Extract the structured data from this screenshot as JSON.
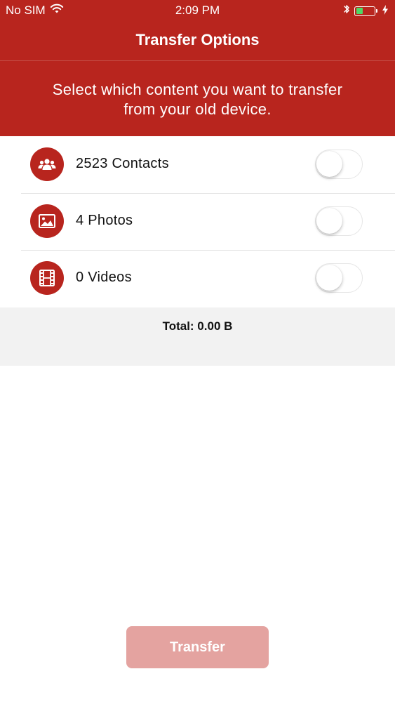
{
  "status_bar": {
    "carrier": "No SIM",
    "time": "2:09 PM",
    "battery_level": 0.45,
    "battery_color": "#4CD964",
    "icons": [
      "wifi-icon",
      "bluetooth-icon",
      "battery-icon",
      "charging-bolt-icon"
    ]
  },
  "nav": {
    "title": "Transfer Options"
  },
  "header": {
    "subtitle": "Select which content you want to transfer from your old device."
  },
  "items": [
    {
      "label": "2523 Contacts",
      "icon": "contacts-icon",
      "enabled": false
    },
    {
      "label": "4 Photos",
      "icon": "photo-icon",
      "enabled": false
    },
    {
      "label": "0 Videos",
      "icon": "film-icon",
      "enabled": false
    }
  ],
  "total": {
    "text": "Total: 0.00 B"
  },
  "transfer_button": {
    "label": "Transfer",
    "disabled": true
  },
  "colors": {
    "brand": "#B8251E",
    "button_disabled": "#E4A3A0",
    "total_background": "#F2F2F2"
  }
}
